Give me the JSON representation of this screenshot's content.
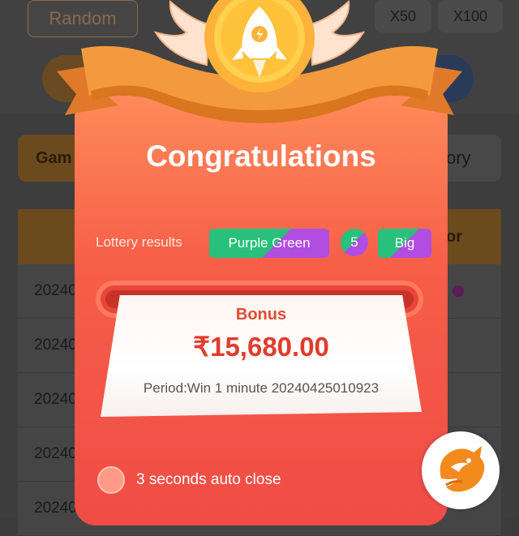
{
  "background": {
    "random_button": "Random",
    "multiplier_buttons": [
      "X50",
      "X100"
    ],
    "tab_left_label": "Gam",
    "tab_right_label": "ory",
    "header_right_label": "or",
    "history_rows": [
      "20240",
      "20240",
      "20240",
      "20240",
      "20240"
    ]
  },
  "dialog": {
    "title": "Congratulations",
    "lottery_results_label": "Lottery results",
    "result_color": "Purple Green",
    "result_number": "5",
    "result_size": "Big",
    "bonus_label": "Bonus",
    "bonus_amount": "₹15,680.00",
    "period_text": "Period:Win 1 minute 20240425010923",
    "auto_close_text": "3 seconds auto close"
  },
  "colors": {
    "card_gradient_top": "#ff8a5a",
    "card_gradient_bottom": "#f04c46",
    "green": "#28c07a",
    "purple": "#b14de0",
    "bonus_red": "#e03c2c"
  },
  "icons": [
    "rocket-icon",
    "wings-icon",
    "ribbon-icon",
    "dragon-logo-icon"
  ]
}
